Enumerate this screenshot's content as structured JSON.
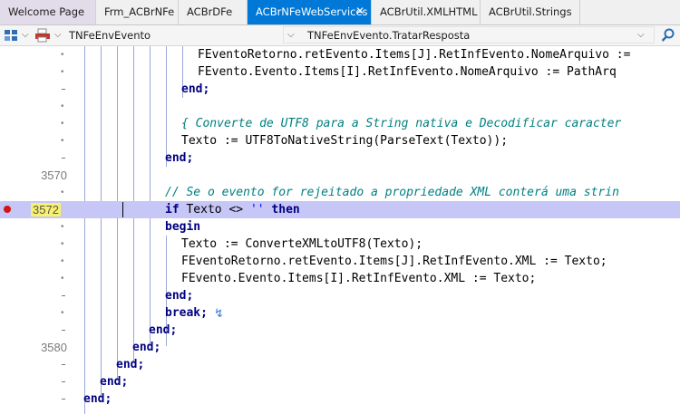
{
  "tabs": [
    {
      "label": "Welcome Page"
    },
    {
      "label": "Frm_ACBrNFe"
    },
    {
      "label": "ACBrDFe"
    },
    {
      "label": "ACBrNFeWebServices"
    },
    {
      "label": "ACBrUtil.XMLHTML"
    },
    {
      "label": "ACBrUtil.Strings"
    }
  ],
  "active_tab_close": "✕",
  "nav": {
    "class_combo": "TNFeEnvEvento",
    "method_combo": "TNFeEnvEvento.TratarResposta"
  },
  "editor": {
    "lines": [
      {
        "gutter": "",
        "text": "FEventoRetorno.retEvento.Items[J].RetInfEvento.NomeArquivo :="
      },
      {
        "gutter": "",
        "text": "FEvento.Evento.Items[I].RetInfEvento.NomeArquivo := PathArq"
      },
      {
        "gutter": "",
        "text": "end;"
      },
      {
        "gutter": "",
        "text": ""
      },
      {
        "gutter": "",
        "text": "{ Converte de UTF8 para a String nativa e Decodificar caracter"
      },
      {
        "gutter": "",
        "text": "Texto := UTF8ToNativeString(ParseText(Texto));"
      },
      {
        "gutter": "",
        "text": "end;"
      },
      {
        "gutter": "3570",
        "text": ""
      },
      {
        "gutter": "",
        "text": "// Se o evento for rejeitado a propriedade XML conterá uma strin"
      },
      {
        "gutter": "3572",
        "text": "if Texto <> '' then"
      },
      {
        "gutter": "",
        "text": "begin"
      },
      {
        "gutter": "",
        "text": "Texto := ConverteXMLtoUTF8(Texto);"
      },
      {
        "gutter": "",
        "text": "FEventoRetorno.retEvento.Items[J].RetInfEvento.XML := Texto;"
      },
      {
        "gutter": "",
        "text": "FEvento.Evento.Items[I].RetInfEvento.XML := Texto;"
      },
      {
        "gutter": "",
        "text": "end;"
      },
      {
        "gutter": "",
        "text": "break;"
      },
      {
        "gutter": "",
        "text": "end;"
      },
      {
        "gutter": "3580",
        "text": "end;"
      },
      {
        "gutter": "",
        "text": "end;"
      },
      {
        "gutter": "",
        "text": "end;"
      },
      {
        "gutter": "",
        "text": "end;"
      }
    ]
  },
  "colors": {
    "active_tab": "#0078d7",
    "execution_line": "#c6c6f7",
    "breakpoint": "#d21414",
    "breakpoint_line_number": "#f7f170",
    "keyword": "#000080",
    "comment": "#008080"
  },
  "icons": [
    "class-browser-icon",
    "chevron-down-icon",
    "printer-icon",
    "search-icon",
    "edit-cursor-icon"
  ]
}
